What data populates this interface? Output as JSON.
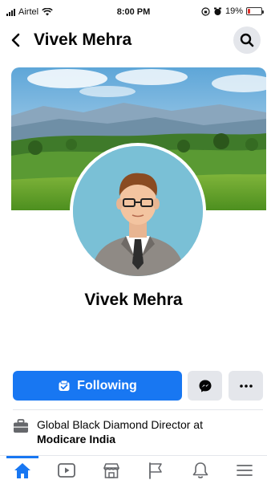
{
  "status_bar": {
    "carrier": "Airtel",
    "time": "8:00 PM",
    "battery": "19%",
    "battery_level": 0.19
  },
  "header": {
    "title": "Vivek Mehra"
  },
  "profile": {
    "name": "Vivek Mehra"
  },
  "actions": {
    "following_label": "Following"
  },
  "work": {
    "role": "Global Black Diamond Director at",
    "company": "Modicare India"
  },
  "tabs": [
    {
      "icon": "home-icon",
      "active": true
    },
    {
      "icon": "video-icon",
      "active": false
    },
    {
      "icon": "marketplace-icon",
      "active": false
    },
    {
      "icon": "pages-flag-icon",
      "active": false
    },
    {
      "icon": "bell-icon",
      "active": false
    },
    {
      "icon": "menu-icon",
      "active": false
    }
  ],
  "colors": {
    "accent": "#1877f2",
    "button_gray": "#e4e6eb",
    "battery_low": "#e0312b"
  }
}
